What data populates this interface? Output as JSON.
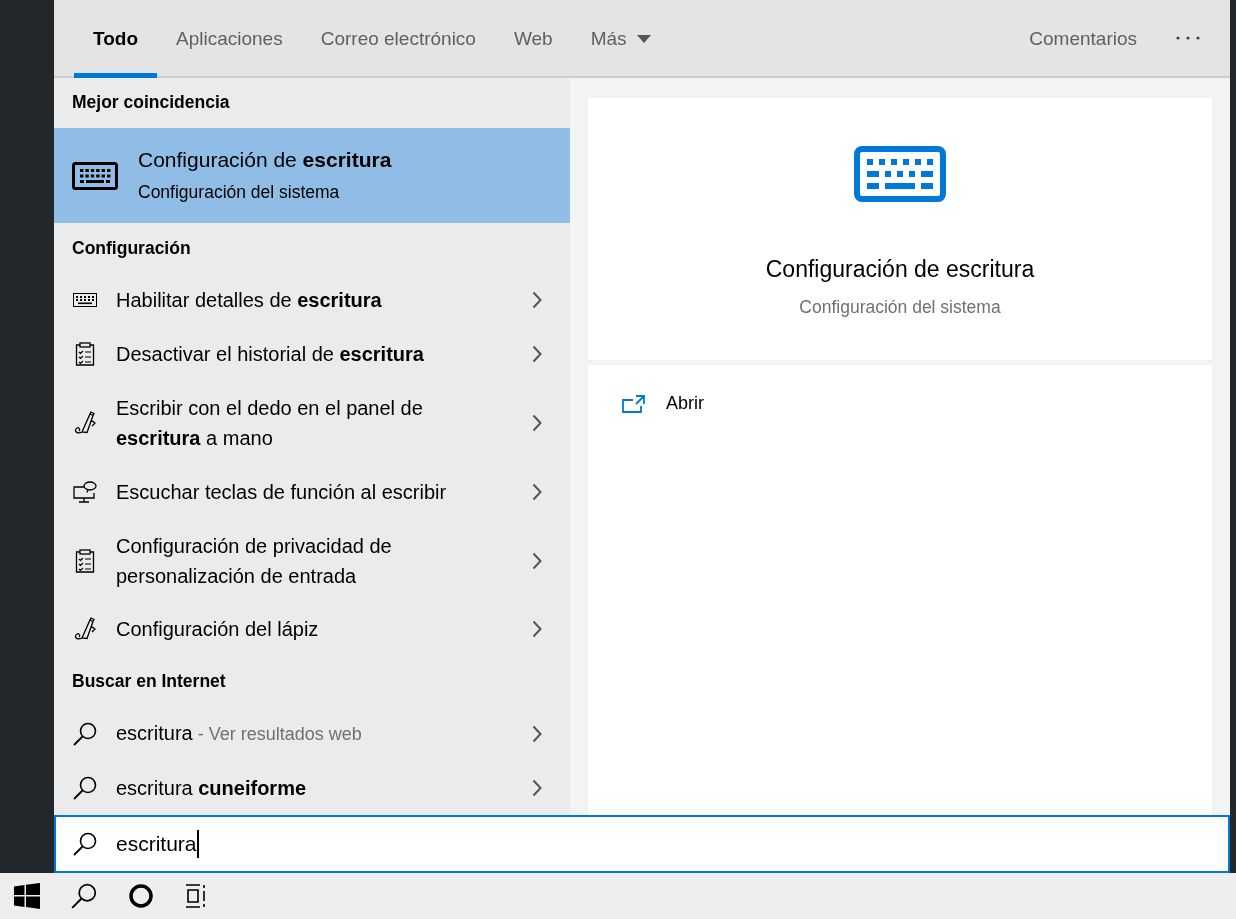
{
  "tabs": [
    {
      "label": "Todo",
      "selected": true,
      "kind": "text"
    },
    {
      "label": "Aplicaciones",
      "selected": false,
      "kind": "text"
    },
    {
      "label": "Correo electrónico",
      "selected": false,
      "kind": "text"
    },
    {
      "label": "Web",
      "selected": false,
      "kind": "text"
    },
    {
      "label": "Más",
      "selected": false,
      "kind": "dropdown"
    }
  ],
  "feedback": "Comentarios",
  "best_match": {
    "header": "Mejor coincidencia",
    "title": "Configuración de **escritura**",
    "subtitle": "Configuración del sistema",
    "selected": true
  },
  "settings": {
    "header": "Configuración",
    "items": [
      {
        "text": "Habilitar detalles de **escritura**",
        "kind": "keyboard"
      },
      {
        "text": "Desactivar el historial de **escritura**",
        "kind": "clipboard"
      },
      {
        "text": "Escribir con el dedo en el panel de **escritura** a mano",
        "kind": "pen"
      },
      {
        "text": "Escuchar teclas de función al escribir",
        "kind": "monitor"
      },
      {
        "text": "Configuración de privacidad de personalización de entrada",
        "kind": "clipboard"
      },
      {
        "text": "Configuración del lápiz",
        "kind": "pen"
      }
    ]
  },
  "web": {
    "header": "Buscar en Internet",
    "items": [
      {
        "text": "escritura",
        "hint": "- Ver resultados web"
      },
      {
        "text": "escritura **cuneiforme**"
      }
    ]
  },
  "preview": {
    "title": "Configuración de escritura",
    "subtitle": "Configuración del sistema",
    "actions": [
      {
        "label": "Abrir"
      }
    ]
  },
  "search": {
    "value": "escritura"
  }
}
